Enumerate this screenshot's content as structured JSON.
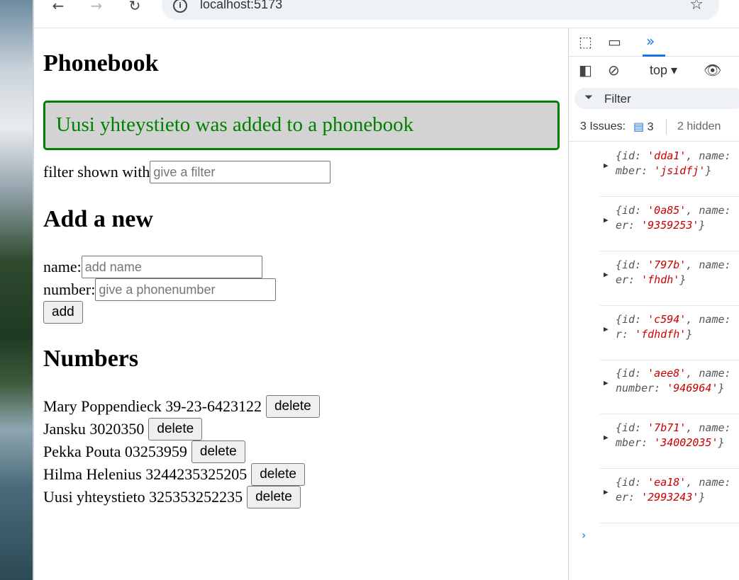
{
  "browser": {
    "url": "localhost:5173",
    "back_icon": "arrow-left",
    "forward_icon": "arrow-right",
    "reload_icon": "reload",
    "bookmark_icon": "star"
  },
  "app": {
    "title": "Phonebook",
    "notification": "Uusi yhteystieto was added to a phonebook",
    "filter_label": "filter shown with",
    "filter_placeholder": "give a filter",
    "add_heading": "Add a new",
    "name_label": "name:",
    "name_placeholder": "add name",
    "number_label": "number:",
    "number_placeholder": "give a phonenumber",
    "add_button": "add",
    "numbers_heading": "Numbers",
    "delete_label": "delete",
    "persons": [
      {
        "text": "Mary Poppendieck 39-23-6423122"
      },
      {
        "text": "Jansku 3020350"
      },
      {
        "text": "Pekka Pouta 03253959"
      },
      {
        "text": "Hilma Helenius 3244235325205"
      },
      {
        "text": "Uusi yhteystieto 325353252235"
      }
    ],
    "colors": {
      "success": "#008000",
      "notification_bg": "#d3d3d3"
    }
  },
  "devtools": {
    "context": "top",
    "filter_label": "Filter",
    "issues_label": "3 Issues:",
    "issues_count": "3",
    "hidden_label": "2 hidden",
    "logs": [
      {
        "id": "'dda1'",
        "line2_key": "mber:",
        "line2_val": "'jsidfj'"
      },
      {
        "id": "'0a85'",
        "line2_key": "er:",
        "line2_val": "'9359253'"
      },
      {
        "id": "'797b'",
        "line2_key": "er:",
        "line2_val": "'fhdh'"
      },
      {
        "id": "'c594'",
        "line2_key": "r:",
        "line2_val": "'fdhdfh'"
      },
      {
        "id": "'aee8'",
        "line2_key": "number:",
        "line2_val": "'946964'"
      },
      {
        "id": "'7b71'",
        "line2_key": "mber:",
        "line2_val": "'34002035'"
      },
      {
        "id": "'ea18'",
        "line2_key": "er:",
        "line2_val": "'2993243'"
      }
    ],
    "log_prefix": "{id: ",
    "log_name": ", name:",
    "log_suffix": "}"
  }
}
